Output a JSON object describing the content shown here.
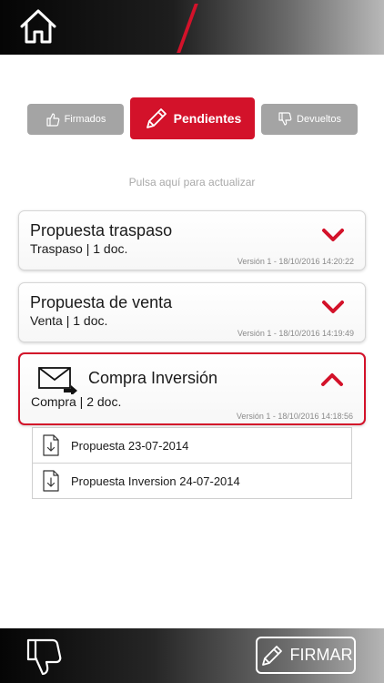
{
  "header": {
    "home_icon": "home-icon"
  },
  "tabs": [
    {
      "label": "Firmados",
      "icon": "thumbs-up-icon",
      "active": false
    },
    {
      "label": "Pendientes",
      "icon": "pencil-icon",
      "active": true
    },
    {
      "label": "Devueltos",
      "icon": "thumbs-down-icon",
      "active": false
    }
  ],
  "refresh_text": "Pulsa aquí para actualizar",
  "documents": [
    {
      "title": "Propuesta traspaso",
      "subtitle": "Traspaso | 1 doc.",
      "version": "Versión 1 - 18/10/2016 14:20:22",
      "expanded": false
    },
    {
      "title": "Propuesta de venta",
      "subtitle": "Venta | 1 doc.",
      "version": "Versión 1 - 18/10/2016 14:19:49",
      "expanded": false
    },
    {
      "title": "Compra Inversión",
      "subtitle": "Compra | 2 doc.",
      "version": "Versión 1 - 18/10/2016 14:18:56",
      "expanded": true,
      "files": [
        "Propuesta 23-07-2014",
        "Propuesta Inversion 24-07-2014"
      ]
    }
  ],
  "footer": {
    "reject_icon": "thumbs-down-icon",
    "sign_label": "FIRMAR"
  },
  "colors": {
    "accent": "#d3122a",
    "tab_inactive": "#a4a4a4",
    "muted_text": "#a9a9a9"
  }
}
